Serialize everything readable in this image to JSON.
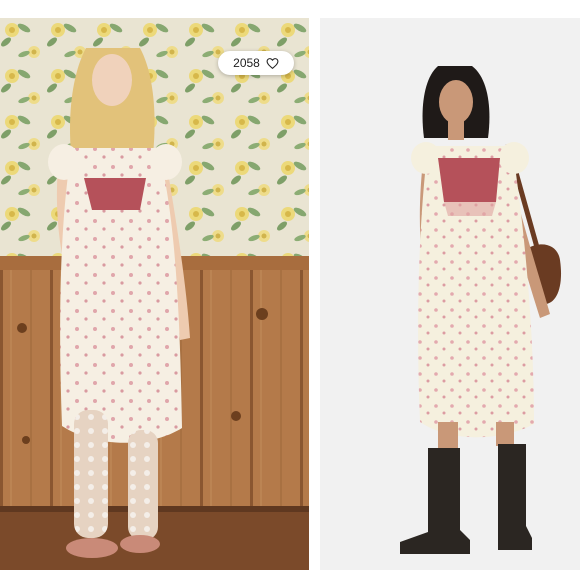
{
  "listing": {
    "like_count": "2058",
    "like_icon": "heart-outline-icon"
  },
  "colors": {
    "wallpaper": "#e8e2cf",
    "wood": "#b07848",
    "dress": "#f6efe3",
    "bodice_trim": "#b5515a",
    "studio_bg": "#f1f1f1",
    "boots": "#2b2622"
  }
}
